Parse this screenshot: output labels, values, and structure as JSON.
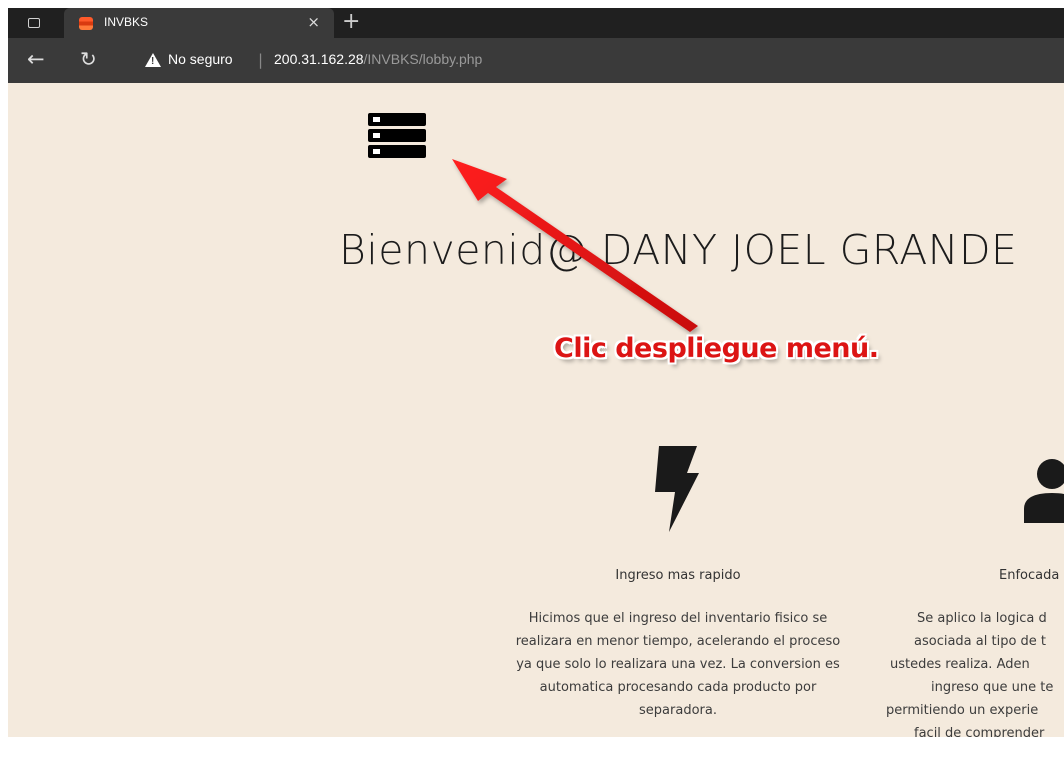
{
  "browser": {
    "tab_title": "INVBKS",
    "close_glyph": "×",
    "newtab_glyph": "+",
    "back_glyph": "←",
    "reload_glyph": "↻",
    "security_label": "No seguro",
    "url_host": "200.31.162.28",
    "url_path": "/INVBKS/lobby.php"
  },
  "page": {
    "menu_icon": "menu-stack-icon",
    "welcome": "Bienvenid@ DANY JOEL GRANDE",
    "annotation": "Clic despliegue menú.",
    "annotation_color": "#dc1414",
    "background": "#f4eadd",
    "features": [
      {
        "icon": "lightning-icon",
        "title": "Ingreso mas rapido",
        "lines": [
          "Hicimos que el ingreso del inventario fisico se",
          "realizara en menor tiempo, acelerando el proceso",
          "ya que solo lo realizara una vez. La conversion es",
          "automatica procesando cada producto por",
          "separadora."
        ]
      },
      {
        "icon": "user-icon",
        "title": "Enfocada",
        "lines": [
          "Se aplico la logica d",
          "asociada al tipo de t",
          "ustedes realiza. Aden",
          "ingreso que une te",
          "permitiendo un experie",
          "facil de comprender"
        ]
      }
    ]
  }
}
